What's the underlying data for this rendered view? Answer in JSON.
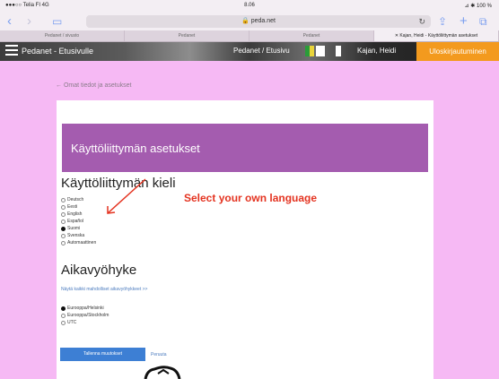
{
  "status_bar": {
    "carrier": "●●●○○ Telia FI  4G",
    "time": "8.06",
    "battery": "⊿ ✱ 100 %"
  },
  "browser": {
    "url": "peda.net",
    "back_icon": "chevron-left-icon",
    "tabs": [
      {
        "label": "Pedanet / sivusto"
      },
      {
        "label": "Pedanet"
      },
      {
        "label": "Pedanet"
      },
      {
        "label": "✕ Kajan, Heidi - Käyttöliittymän asetukset",
        "active": true
      }
    ]
  },
  "site_nav": {
    "brand": "Pedanet - Etusivulle",
    "middle": "Pedanet / Etusivu",
    "user": "Kajan, Heidi",
    "logout_label": "Uloskirjautuminen"
  },
  "back_link": "← Omat tiedot ja asetukset",
  "panel": {
    "header_title": "Käyttöliittymän asetukset",
    "language_section": {
      "title": "Käyttöliittymän kieli",
      "options": [
        {
          "label": "Deutsch",
          "checked": false
        },
        {
          "label": "Eesti",
          "checked": false
        },
        {
          "label": "English",
          "checked": false
        },
        {
          "label": "Español",
          "checked": false
        },
        {
          "label": "Suomi",
          "checked": true
        },
        {
          "label": "Svenska",
          "checked": false
        },
        {
          "label": "Automaattinen",
          "checked": false
        }
      ]
    },
    "annotation": "Select your own language",
    "timezone_section": {
      "title": "Aikavyöhyke",
      "show_all_link": "Näytä kaikki mahdolliset aikavyöhykkeet >>",
      "options": [
        {
          "label": "Eurooppa/Helsinki",
          "checked": true
        },
        {
          "label": "Eurooppa/Stockholm",
          "checked": false
        },
        {
          "label": "UTC",
          "checked": false
        }
      ]
    },
    "save_label": "Tallenna muutokset",
    "cancel_label": "Peruuta"
  },
  "colors": {
    "background": "#f6b9f4",
    "panel_header": "#a45caf",
    "save_button": "#3d7fd4",
    "logout_button": "#f39a1e",
    "annotation": "#e43320"
  }
}
